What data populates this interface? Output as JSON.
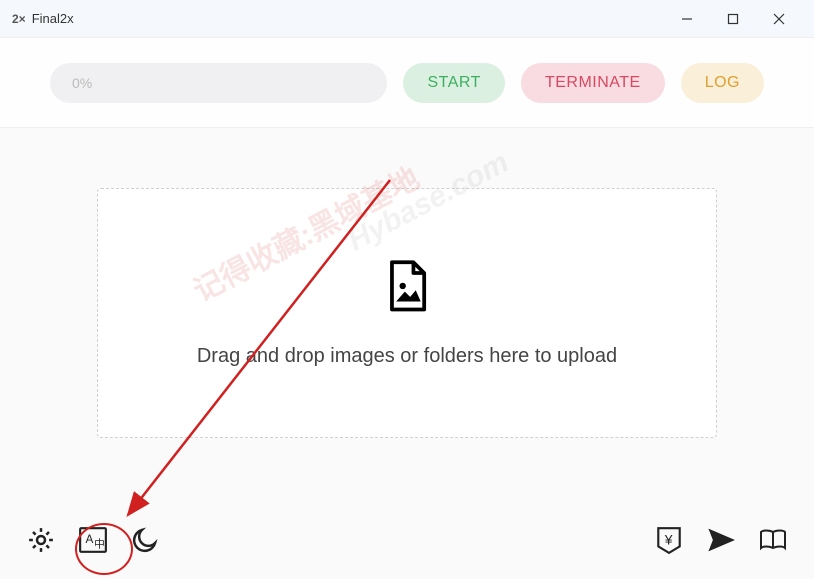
{
  "app": {
    "title": "Final2x",
    "icon_text": "2×"
  },
  "toolbar": {
    "progress": "0%",
    "start_label": "START",
    "terminate_label": "TERMINATE",
    "log_label": "LOG"
  },
  "drop_zone": {
    "text": "Drag and drop images or folders here to upload"
  },
  "watermarks": {
    "wm1": "记得收藏:黑域基地",
    "wm2": "Hybase.com"
  }
}
